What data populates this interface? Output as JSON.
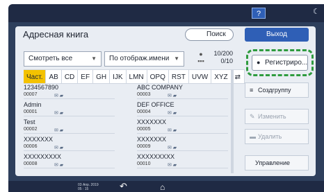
{
  "system": {
    "help_label": "?",
    "date_line1": "03 Апр. 2019",
    "date_line2": "05 : 15"
  },
  "header": {
    "title": "Адресная книга",
    "search_label": "Поиск",
    "exit_label": "Выход"
  },
  "filters": {
    "view": "Смотреть все",
    "sort": "По отображ.имени",
    "count_top": "10/200",
    "count_bottom": "0/10"
  },
  "tabs": [
    "Част.",
    "AB",
    "CD",
    "EF",
    "GH",
    "IJK",
    "LMN",
    "OPQ",
    "RST",
    "UVW",
    "XYZ"
  ],
  "entries": [
    {
      "name": "1234567890",
      "number": "00007"
    },
    {
      "name": "ABC COMPANY",
      "number": "00003"
    },
    {
      "name": "Admin",
      "number": "00001"
    },
    {
      "name": "DEF OFFICE",
      "number": "00004"
    },
    {
      "name": "Test",
      "number": "00002"
    },
    {
      "name": "XXXXXXX",
      "number": "00005"
    },
    {
      "name": "XXXXXXX",
      "number": "00006"
    },
    {
      "name": "XXXXXXX",
      "number": "00009"
    },
    {
      "name": "XXXXXXXXX",
      "number": "00008"
    },
    {
      "name": "XXXXXXXXX",
      "number": "00010"
    }
  ],
  "actions": {
    "register": "Регистриро...",
    "group": "Создгруппу",
    "edit": "Изменить",
    "delete": "Удалить",
    "manage": "Управление"
  },
  "colors": {
    "accent": "#2f5fb6",
    "active_tab": "#f4c200",
    "highlight": "#2e9b3e"
  }
}
